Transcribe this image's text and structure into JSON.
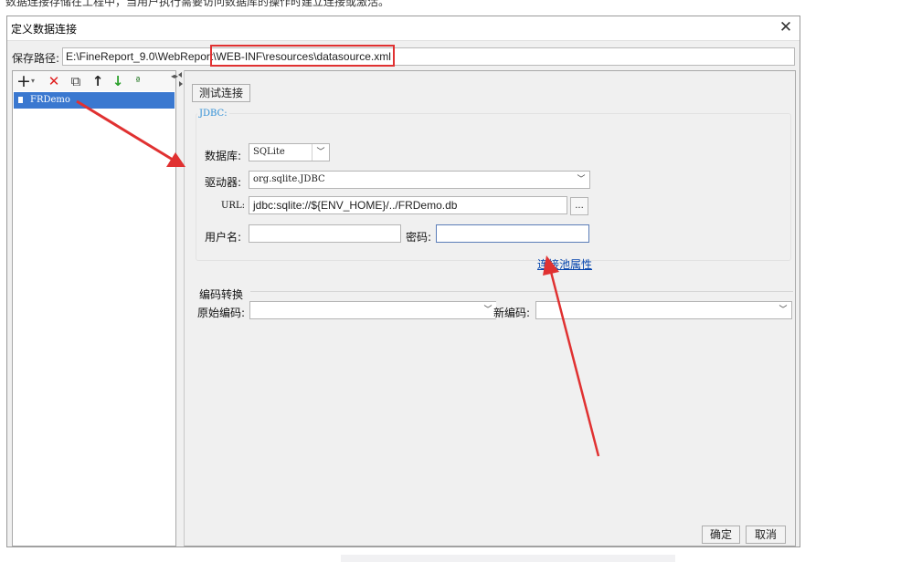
{
  "top_caption": "数据连接存储在工程中，当用户执行需要访问数据库的操作时建立连接或激活。",
  "dialog": {
    "title": "定义数据连接",
    "close_glyph": "✕"
  },
  "save_path": {
    "label": "保存路径:",
    "value": "E:\\FineReport_9.0\\WebReport\\WEB-INF\\resources\\datasource.xml"
  },
  "toolbar": {
    "add": "+",
    "add_dropdown": "▾",
    "delete": "✕",
    "copy": "⧉",
    "move_up": "↑",
    "move_down": "↓",
    "sort": "ª",
    "more": "◂▸"
  },
  "connections": [
    {
      "label": "FRDemo",
      "selected": true
    }
  ],
  "test_button": "测试连接",
  "jdbc": {
    "title": "JDBC:",
    "database_label": "数据库:",
    "database_value": "SQLite",
    "driver_label": "驱动器:",
    "driver_value": "org.sqlite.JDBC",
    "url_label": "URL:",
    "url_value": "jdbc:sqlite://${ENV_HOME}/../FRDemo.db",
    "url_browse": "...",
    "username_label": "用户名:",
    "username_value": "",
    "password_label": "密码:",
    "password_value": "",
    "pool_link": "连接池属性"
  },
  "encoding": {
    "title": "编码转换",
    "original_label": "原始编码:",
    "original_value": "",
    "new_label": "新编码:",
    "new_value": ""
  },
  "buttons": {
    "ok": "确定",
    "cancel": "取消"
  },
  "colors": {
    "annotation_red": "#e03131",
    "selection_blue": "#3a78d0",
    "link_blue": "#0645ad",
    "jdbc_title": "#2f8fd6"
  }
}
